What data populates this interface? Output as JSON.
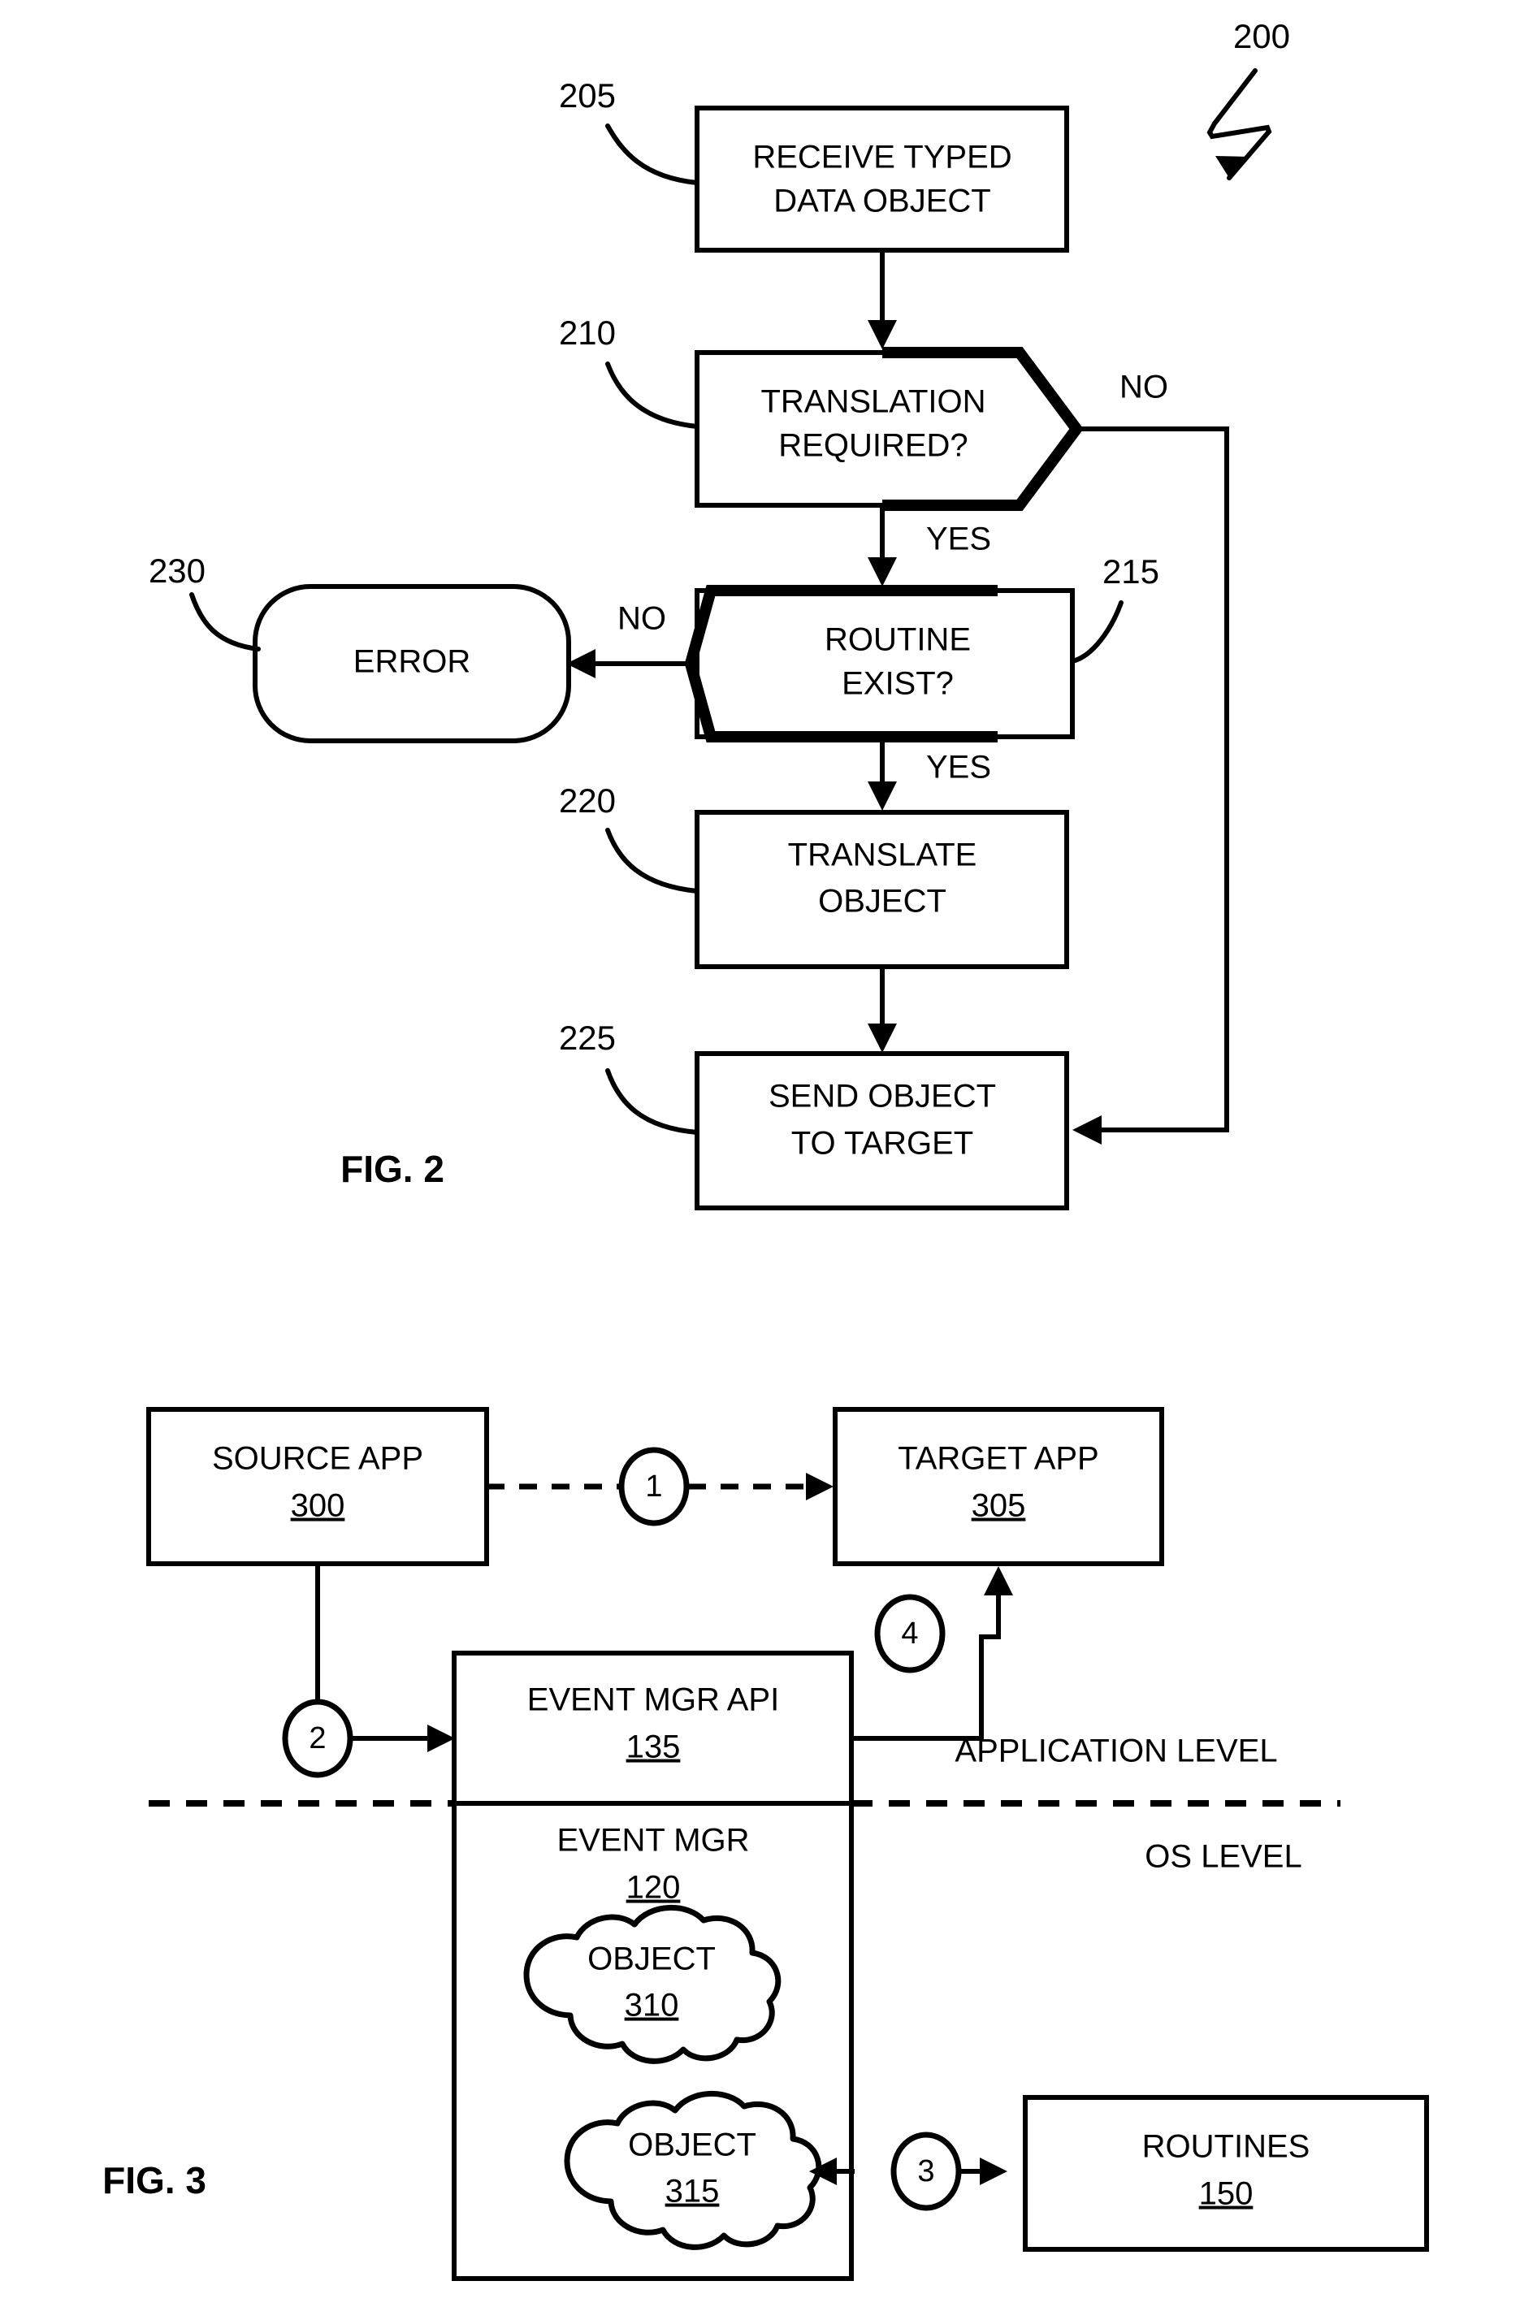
{
  "document": {
    "type": "patent-drawing-sheet",
    "figures": [
      "FIG. 2",
      "FIG. 3"
    ]
  },
  "fig2": {
    "label": "FIG. 2",
    "overall_ref": "200",
    "nodes": [
      {
        "id": "n205",
        "ref": "205",
        "shape": "rect",
        "line1": "RECEIVE TYPED",
        "line2": "DATA OBJECT"
      },
      {
        "id": "n210",
        "ref": "210",
        "shape": "decision-out",
        "line1": "TRANSLATION",
        "line2": "REQUIRED?"
      },
      {
        "id": "n215",
        "ref": "215",
        "shape": "decision-in",
        "line1": "ROUTINE",
        "line2": "EXIST?"
      },
      {
        "id": "n220",
        "ref": "220",
        "shape": "rect",
        "line1": "TRANSLATE",
        "line2": "OBJECT"
      },
      {
        "id": "n225",
        "ref": "225",
        "shape": "rect",
        "line1": "SEND OBJECT",
        "line2": "TO TARGET"
      },
      {
        "id": "n230",
        "ref": "230",
        "shape": "rounded",
        "line1": "ERROR",
        "line2": ""
      }
    ],
    "branch_labels": {
      "translation_no": "NO",
      "translation_yes": "YES",
      "routine_no": "NO",
      "routine_yes": "YES"
    }
  },
  "fig3": {
    "label": "FIG. 3",
    "levels": {
      "application": "APPLICATION LEVEL",
      "os": "OS LEVEL"
    },
    "boxes": [
      {
        "id": "source_app",
        "title": "SOURCE APP",
        "ref": "300"
      },
      {
        "id": "target_app",
        "title": "TARGET APP",
        "ref": "305"
      },
      {
        "id": "event_mgr_api",
        "title": "EVENT MGR API",
        "ref": "135"
      },
      {
        "id": "event_mgr",
        "title": "EVENT MGR",
        "ref": "120"
      },
      {
        "id": "routines",
        "title": "ROUTINES",
        "ref": "150"
      }
    ],
    "clouds": [
      {
        "id": "object_310",
        "title": "OBJECT",
        "ref": "310"
      },
      {
        "id": "object_315",
        "title": "OBJECT",
        "ref": "315"
      }
    ],
    "step_markers": [
      "1",
      "2",
      "3",
      "4"
    ]
  },
  "colors": {
    "ink": "#000000",
    "paper": "#ffffff"
  }
}
